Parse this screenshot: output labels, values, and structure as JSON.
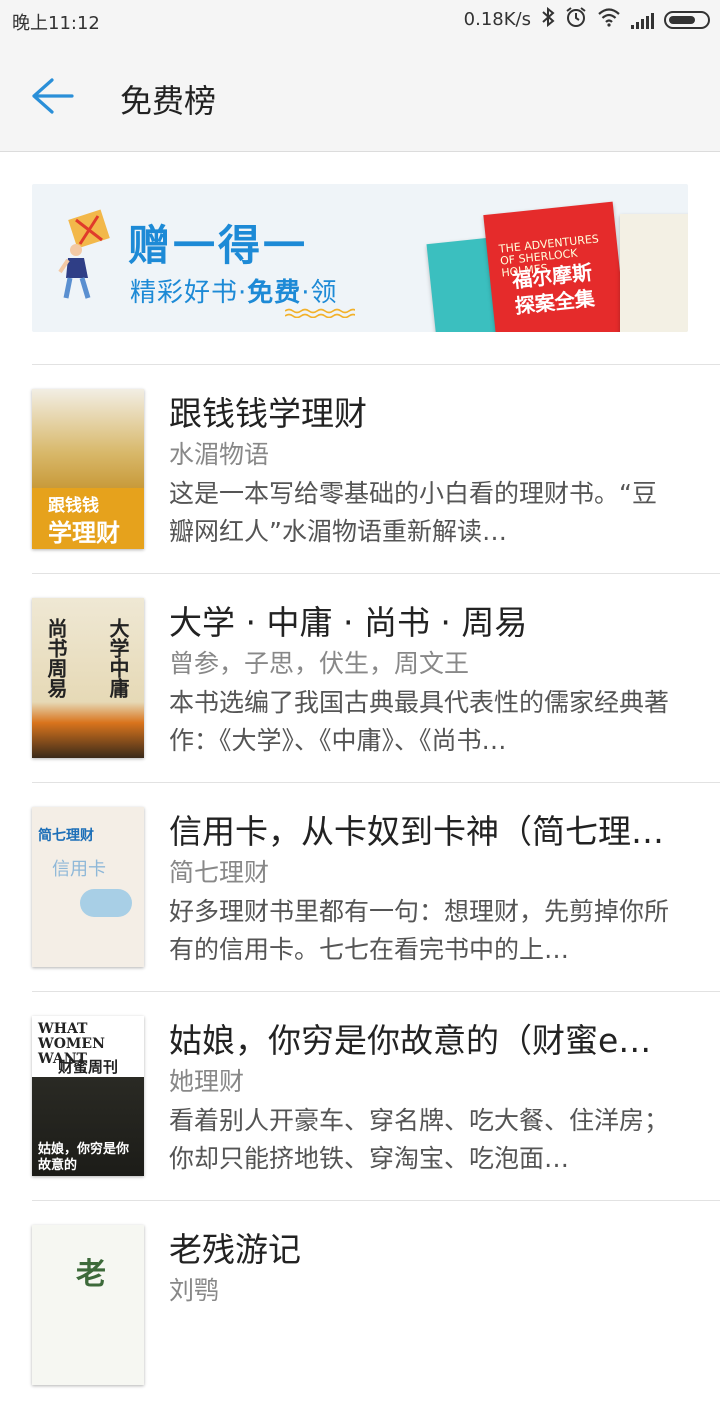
{
  "status_bar": {
    "time": "晚上11:12",
    "network_speed": "0.18K/s",
    "icons": [
      "bluetooth-icon",
      "alarm-icon",
      "wifi-icon",
      "signal-icon",
      "battery-icon"
    ]
  },
  "header": {
    "title": "免费榜",
    "back_icon": "arrow-left-icon",
    "accent_color": "#2a8fd8"
  },
  "banner": {
    "headline": "赠一得一",
    "subline_prefix": "精彩好书·",
    "subline_highlight": "免费",
    "subline_suffix": "·领",
    "books": [
      {
        "cover_title": "福尔摩斯"
      },
      {
        "cover_title": "探案全集"
      },
      {
        "cover_subtitle": "THE ADVENTURES OF SHERLOCK HOLMES"
      }
    ]
  },
  "books": [
    {
      "title": "跟钱钱学理财",
      "author": "水湄物语",
      "desc": "这是一本写给零基础的小白看的理财书。“豆瓣网红人”水湄物语重新解读…",
      "cover_line1": "跟钱钱",
      "cover_line2": "学理财"
    },
    {
      "title": "大学 · 中庸 · 尚书 · 周易",
      "author": "曾参，子思，伏生，周文王",
      "desc": "本书选编了我国古典最具代表性的儒家经典著作：《大学》、《中庸》、《尚书…",
      "cover_line1": "尚书周易",
      "cover_line2": "大学中庸"
    },
    {
      "title": "信用卡，从卡奴到卡神（简七理…",
      "author": "简七理财",
      "desc": "好多理财书里都有一句：想理财，先剪掉你所有的信用卡。七七在看完书中的上…",
      "cover_line1": "简七理财",
      "cover_line2": "信用卡"
    },
    {
      "title": "姑娘，你穷是你故意的（财蜜e…",
      "author": "她理财",
      "desc": "看着别人开豪车、穿名牌、吃大餐、住洋房；你却只能挤地铁、穿淘宝、吃泡面…",
      "cover_line1": "WHAT WOMEN WANT",
      "cover_line2": "财蜜周刊",
      "cover_line3": "姑娘，你穷是你故意的"
    },
    {
      "title": "老残游记",
      "author": "刘鹗",
      "desc": "",
      "cover_line1": "老"
    }
  ]
}
